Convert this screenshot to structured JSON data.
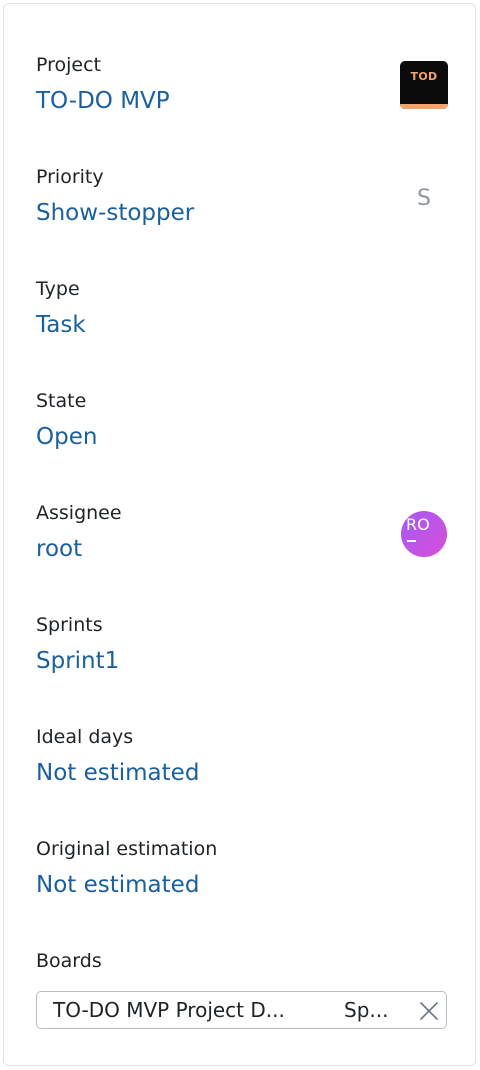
{
  "fields": {
    "project": {
      "label": "Project",
      "value": "TO-DO MVP",
      "badge": "TOD"
    },
    "priority": {
      "label": "Priority",
      "value": "Show-stopper",
      "letter": "S"
    },
    "type": {
      "label": "Type",
      "value": "Task"
    },
    "state": {
      "label": "State",
      "value": "Open"
    },
    "assignee": {
      "label": "Assignee",
      "value": "root",
      "avatar": "RO"
    },
    "sprints": {
      "label": "Sprints",
      "value": "Sprint1"
    },
    "ideal_days": {
      "label": "Ideal days",
      "value": "Not estimated"
    },
    "original_estimation": {
      "label": "Original estimation",
      "value": "Not estimated"
    },
    "boards": {
      "label": "Boards",
      "tag_name": "TO-DO MVP Project D...",
      "tag_sprint": "Sp..."
    }
  },
  "colors": {
    "link": "#1a5f9e",
    "label": "#1f2326",
    "project_badge_bg": "#0b0b0b",
    "project_badge_accent": "#f4a46a",
    "priority_letter": "#8f969e",
    "avatar_gradient_start": "#a35bf0",
    "avatar_gradient_end": "#d94ddb"
  },
  "icons": {
    "board_tag_remove": "close-icon"
  }
}
